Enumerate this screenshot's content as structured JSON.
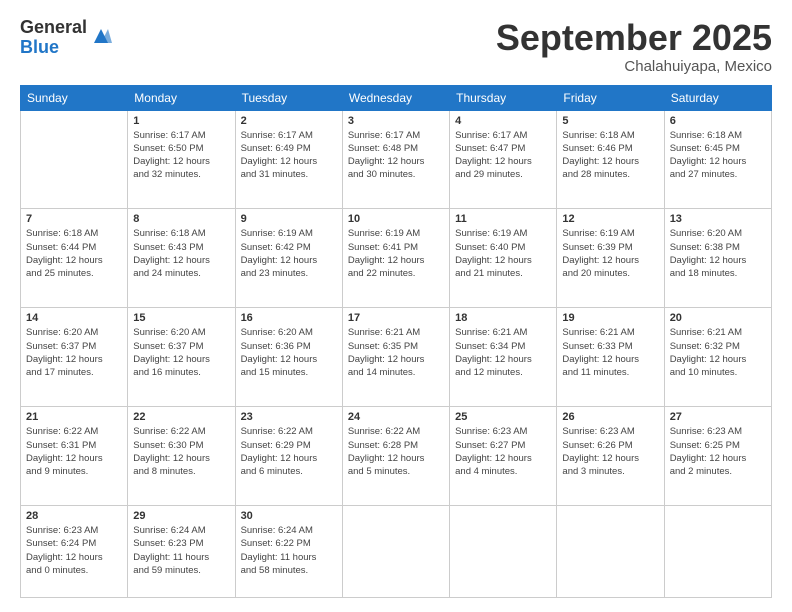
{
  "logo": {
    "general": "General",
    "blue": "Blue"
  },
  "title": "September 2025",
  "location": "Chalahuiyapa, Mexico",
  "days_of_week": [
    "Sunday",
    "Monday",
    "Tuesday",
    "Wednesday",
    "Thursday",
    "Friday",
    "Saturday"
  ],
  "weeks": [
    [
      {
        "day": "",
        "info": ""
      },
      {
        "day": "1",
        "info": "Sunrise: 6:17 AM\nSunset: 6:50 PM\nDaylight: 12 hours\nand 32 minutes."
      },
      {
        "day": "2",
        "info": "Sunrise: 6:17 AM\nSunset: 6:49 PM\nDaylight: 12 hours\nand 31 minutes."
      },
      {
        "day": "3",
        "info": "Sunrise: 6:17 AM\nSunset: 6:48 PM\nDaylight: 12 hours\nand 30 minutes."
      },
      {
        "day": "4",
        "info": "Sunrise: 6:17 AM\nSunset: 6:47 PM\nDaylight: 12 hours\nand 29 minutes."
      },
      {
        "day": "5",
        "info": "Sunrise: 6:18 AM\nSunset: 6:46 PM\nDaylight: 12 hours\nand 28 minutes."
      },
      {
        "day": "6",
        "info": "Sunrise: 6:18 AM\nSunset: 6:45 PM\nDaylight: 12 hours\nand 27 minutes."
      }
    ],
    [
      {
        "day": "7",
        "info": "Sunrise: 6:18 AM\nSunset: 6:44 PM\nDaylight: 12 hours\nand 25 minutes."
      },
      {
        "day": "8",
        "info": "Sunrise: 6:18 AM\nSunset: 6:43 PM\nDaylight: 12 hours\nand 24 minutes."
      },
      {
        "day": "9",
        "info": "Sunrise: 6:19 AM\nSunset: 6:42 PM\nDaylight: 12 hours\nand 23 minutes."
      },
      {
        "day": "10",
        "info": "Sunrise: 6:19 AM\nSunset: 6:41 PM\nDaylight: 12 hours\nand 22 minutes."
      },
      {
        "day": "11",
        "info": "Sunrise: 6:19 AM\nSunset: 6:40 PM\nDaylight: 12 hours\nand 21 minutes."
      },
      {
        "day": "12",
        "info": "Sunrise: 6:19 AM\nSunset: 6:39 PM\nDaylight: 12 hours\nand 20 minutes."
      },
      {
        "day": "13",
        "info": "Sunrise: 6:20 AM\nSunset: 6:38 PM\nDaylight: 12 hours\nand 18 minutes."
      }
    ],
    [
      {
        "day": "14",
        "info": "Sunrise: 6:20 AM\nSunset: 6:37 PM\nDaylight: 12 hours\nand 17 minutes."
      },
      {
        "day": "15",
        "info": "Sunrise: 6:20 AM\nSunset: 6:37 PM\nDaylight: 12 hours\nand 16 minutes."
      },
      {
        "day": "16",
        "info": "Sunrise: 6:20 AM\nSunset: 6:36 PM\nDaylight: 12 hours\nand 15 minutes."
      },
      {
        "day": "17",
        "info": "Sunrise: 6:21 AM\nSunset: 6:35 PM\nDaylight: 12 hours\nand 14 minutes."
      },
      {
        "day": "18",
        "info": "Sunrise: 6:21 AM\nSunset: 6:34 PM\nDaylight: 12 hours\nand 12 minutes."
      },
      {
        "day": "19",
        "info": "Sunrise: 6:21 AM\nSunset: 6:33 PM\nDaylight: 12 hours\nand 11 minutes."
      },
      {
        "day": "20",
        "info": "Sunrise: 6:21 AM\nSunset: 6:32 PM\nDaylight: 12 hours\nand 10 minutes."
      }
    ],
    [
      {
        "day": "21",
        "info": "Sunrise: 6:22 AM\nSunset: 6:31 PM\nDaylight: 12 hours\nand 9 minutes."
      },
      {
        "day": "22",
        "info": "Sunrise: 6:22 AM\nSunset: 6:30 PM\nDaylight: 12 hours\nand 8 minutes."
      },
      {
        "day": "23",
        "info": "Sunrise: 6:22 AM\nSunset: 6:29 PM\nDaylight: 12 hours\nand 6 minutes."
      },
      {
        "day": "24",
        "info": "Sunrise: 6:22 AM\nSunset: 6:28 PM\nDaylight: 12 hours\nand 5 minutes."
      },
      {
        "day": "25",
        "info": "Sunrise: 6:23 AM\nSunset: 6:27 PM\nDaylight: 12 hours\nand 4 minutes."
      },
      {
        "day": "26",
        "info": "Sunrise: 6:23 AM\nSunset: 6:26 PM\nDaylight: 12 hours\nand 3 minutes."
      },
      {
        "day": "27",
        "info": "Sunrise: 6:23 AM\nSunset: 6:25 PM\nDaylight: 12 hours\nand 2 minutes."
      }
    ],
    [
      {
        "day": "28",
        "info": "Sunrise: 6:23 AM\nSunset: 6:24 PM\nDaylight: 12 hours\nand 0 minutes."
      },
      {
        "day": "29",
        "info": "Sunrise: 6:24 AM\nSunset: 6:23 PM\nDaylight: 11 hours\nand 59 minutes."
      },
      {
        "day": "30",
        "info": "Sunrise: 6:24 AM\nSunset: 6:22 PM\nDaylight: 11 hours\nand 58 minutes."
      },
      {
        "day": "",
        "info": ""
      },
      {
        "day": "",
        "info": ""
      },
      {
        "day": "",
        "info": ""
      },
      {
        "day": "",
        "info": ""
      }
    ]
  ]
}
